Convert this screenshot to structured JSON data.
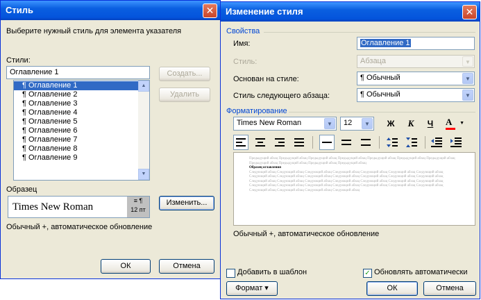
{
  "style_dialog": {
    "title": "Стиль",
    "prompt": "Выберите нужный стиль для элемента указателя",
    "styles_label": "Стили:",
    "style_name_value": "Оглавление 1",
    "styles_list": [
      "¶ Оглавление 1",
      "¶ Оглавление 2",
      "¶ Оглавление 3",
      "¶ Оглавление 4",
      "¶ Оглавление 5",
      "¶ Оглавление 6",
      "¶ Оглавление 7",
      "¶ Оглавление 8",
      "¶ Оглавление 9"
    ],
    "create_button": "Создать...",
    "delete_button": "Удалить",
    "sample_label": "Образец",
    "sample_font": "Times New Roman",
    "sample_size": "12 пт",
    "modify_button": "Изменить...",
    "description": "Обычный +, автоматическое обновление",
    "ok_button": "ОК",
    "cancel_button": "Отмена"
  },
  "modify_dialog": {
    "title": "Изменение стиля",
    "properties_header": "Свойства",
    "name_label": "Имя:",
    "name_value": "Оглавление 1",
    "style_type_label": "Стиль:",
    "style_type_value": "Абзаца",
    "based_on_label": "Основан на стиле:",
    "based_on_value": "¶ Обычный",
    "next_style_label": "Стиль следующего абзаца:",
    "next_style_value": "¶ Обычный",
    "formatting_header": "Форматирование",
    "font_value": "Times New Roman",
    "size_value": "12",
    "bold_label": "Ж",
    "italic_label": "К",
    "underline_label": "Ч",
    "font_color_label": "A",
    "preview_prev": "Предыдущий абзац Предыдущий абзац Предыдущий абзац Предыдущий абзац Предыдущий абзац Предыдущий абзац Предыдущий абзац Предыдущий абзац Предыдущий абзац Предыдущий абзац Предыдущий абзац",
    "preview_sample": "Образец оглавления",
    "preview_next": "Следующий абзац Следующий абзац Следующий абзац Следующий абзац Следующий абзац Следующий абзац Следующий абзац Следующий абзац Следующий абзац Следующий абзац Следующий абзац Следующий абзац Следующий абзац Следующий абзац Следующий абзац Следующий абзац Следующий абзац Следующий абзац Следующий абзац Следующий абзац Следующий абзац Следующий абзац Следующий абзац Следующий абзац Следующий абзац Следующий абзац Следующий абзац Следующий абзац Следующий абзац Следующий абзац Следующий абзац Следующий абзац",
    "description": "Обычный +, автоматическое обновление",
    "add_to_template_label": "Добавить в шаблон",
    "auto_update_label": "Обновлять автоматически",
    "add_to_template_checked": false,
    "auto_update_checked": true,
    "format_button": "Формат ▾",
    "ok_button": "ОК",
    "cancel_button": "Отмена"
  },
  "colors": {
    "titlebar": "#0454dc",
    "selection": "#316ac5",
    "section_header": "#0046d5",
    "font_color_swatch": "#ff0000"
  }
}
